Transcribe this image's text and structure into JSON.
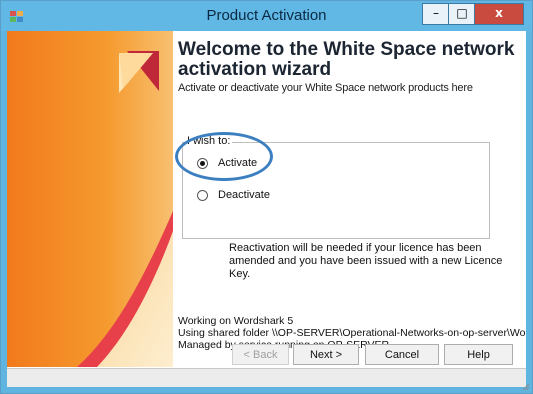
{
  "window": {
    "title": "Product Activation",
    "controls": {
      "minimize": "–",
      "maximize": "□",
      "close": "x"
    }
  },
  "wizard": {
    "heading": "Welcome to the White Space network activation wizard",
    "subheading": "Activate or deactivate your White Space network products here"
  },
  "options": {
    "group_label": "I wish to:",
    "activate_label": "Activate",
    "deactivate_label": "Deactivate",
    "selected": "Activate"
  },
  "note": "Reactivation will be needed if your licence has been amended and you have been issued with a new Licence Key.",
  "status": {
    "line1": "Working on Wordshark 5",
    "line2": "Using shared folder \\\\OP-SERVER\\Operational-Networks-on-op-server\\Word",
    "line3": "Managed by service running on OP-SERVER"
  },
  "buttons": {
    "back": "< Back",
    "next": "Next >",
    "cancel": "Cancel",
    "help": "Help"
  }
}
